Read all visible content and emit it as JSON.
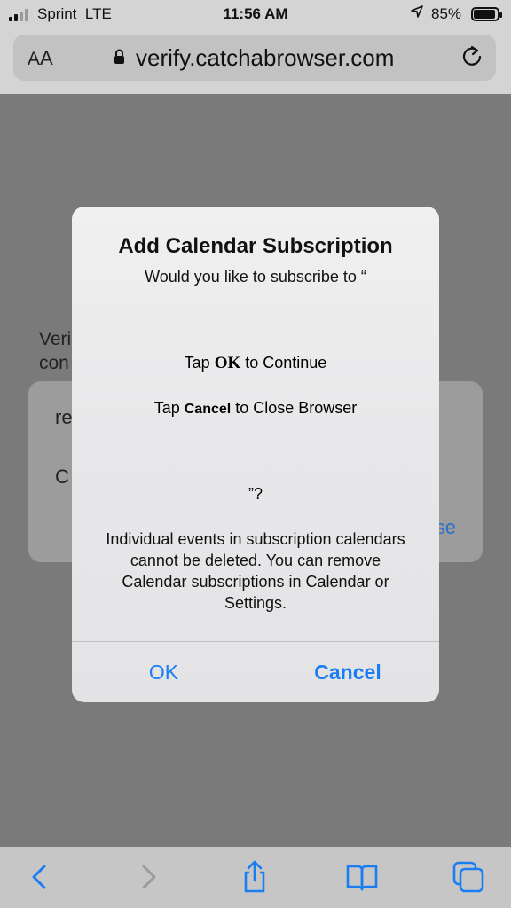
{
  "status_bar": {
    "carrier": "Sprint",
    "network": "LTE",
    "time": "11:56 AM",
    "battery_percent": "85%",
    "battery_level": 0.85
  },
  "url_bar": {
    "text_size_label": "AA",
    "url": "verify.catchabrowser.com"
  },
  "background_page": {
    "text_line1": "Veri",
    "text_line2": "con",
    "sheet_line1": "re",
    "sheet_line2": "C",
    "sheet_action": "se"
  },
  "alert": {
    "title": "Add Calendar Subscription",
    "message": "Would you like to subscribe to “",
    "tap_ok_prefix": "Tap ",
    "tap_ok_bold": "OK",
    "tap_ok_suffix": " to Continue",
    "tap_cancel_prefix": "Tap ",
    "tap_cancel_bold": "Cancel",
    "tap_cancel_suffix": " to Close Browser",
    "close_quote": "”?",
    "note": "Individual events in subscription calendars cannot be deleted. You can remove Calendar subscriptions in Calendar or Settings.",
    "ok_label": "OK",
    "cancel_label": "Cancel"
  },
  "colors": {
    "accent": "#1a7df2",
    "dim_overlay": "#7a7a7a"
  },
  "toolbar_icons": [
    "back-icon",
    "forward-icon",
    "share-icon",
    "bookmarks-icon",
    "tabs-icon"
  ]
}
